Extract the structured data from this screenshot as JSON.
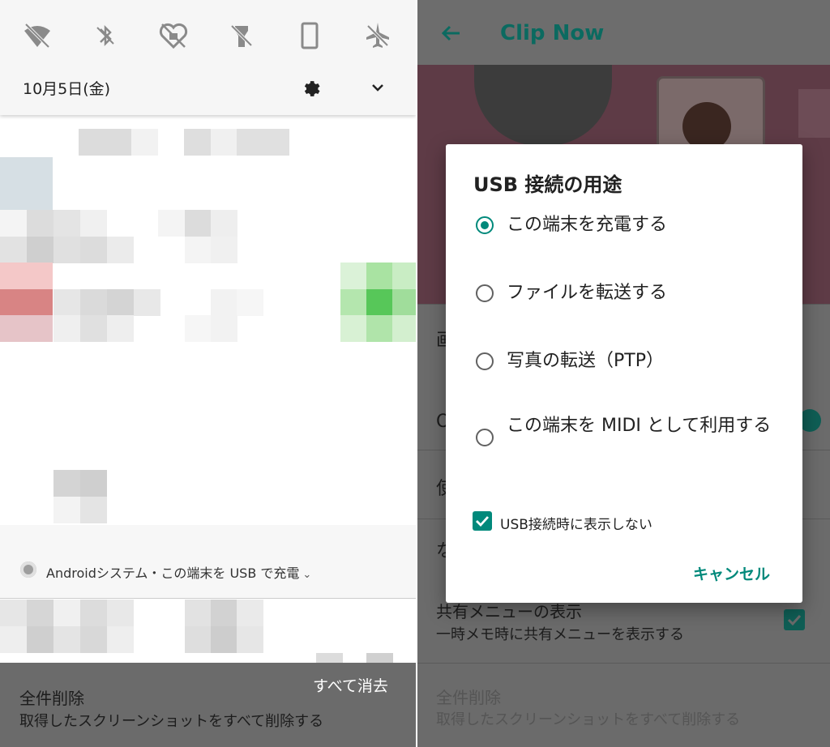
{
  "notification_shade": {
    "date": "10月5日(金)",
    "icons": [
      "wifi-off-icon",
      "bluetooth-off-icon",
      "do-not-disturb-icon",
      "flashlight-off-icon",
      "auto-rotate-icon",
      "airplane-mode-off-icon"
    ],
    "notification_text": "Androidシステム・この端末を USB で充電",
    "clear_all_label": "すべて消去",
    "bottom_title": "全件削除",
    "bottom_subtitle": "取得したスクリーンショットをすべて削除する"
  },
  "app": {
    "title": "Clip Now",
    "settings": {
      "peek_labels": [
        "画",
        "O",
        "使",
        "な"
      ],
      "share_title": "共有メニューの表示",
      "share_subtitle": "一時メモ時に共有メニューを表示する",
      "share_checked": true,
      "delete_title": "全件削除",
      "delete_subtitle": "取得したスクリーンショットをすべて削除する"
    }
  },
  "dialog": {
    "title": "USB 接続の用途",
    "options": [
      {
        "label": "この端末を充電する",
        "selected": true
      },
      {
        "label": "ファイルを転送する",
        "selected": false
      },
      {
        "label": "写真の転送（PTP）",
        "selected": false
      },
      {
        "label": "この端末を MIDI として利用する",
        "selected": false
      }
    ],
    "checkbox_label": "USB接続時に表示しない",
    "checkbox_checked": true,
    "cancel_label": "キャンセル"
  },
  "colors": {
    "accent": "#00897b",
    "dim_accent": "#0b6a60",
    "scrim": "#6b6b6b"
  }
}
